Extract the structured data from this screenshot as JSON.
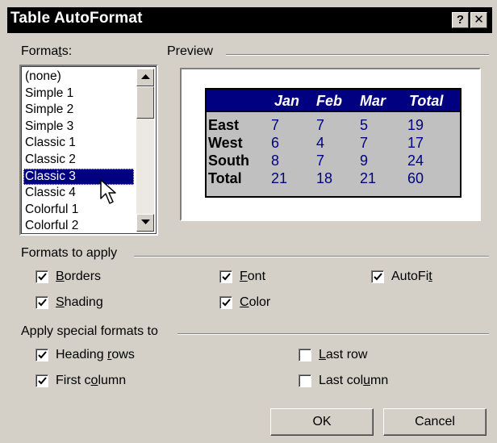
{
  "window": {
    "title": "Table AutoFormat",
    "help_btn": "?",
    "close_btn": "✕"
  },
  "formats": {
    "label_pre": "Forma",
    "label_key": "t",
    "label_post": "s:",
    "items": [
      "(none)",
      "Simple 1",
      "Simple 2",
      "Simple 3",
      "Classic 1",
      "Classic 2",
      "Classic 3",
      "Classic 4",
      "Colorful 1",
      "Colorful 2"
    ],
    "selected": "Classic 3"
  },
  "preview": {
    "label": "Preview",
    "header": [
      "",
      "Jan",
      "Feb",
      "Mar",
      "Total"
    ],
    "rows": [
      [
        "East",
        "7",
        "7",
        "5",
        "19"
      ],
      [
        "West",
        "6",
        "4",
        "7",
        "17"
      ],
      [
        "South",
        "8",
        "7",
        "9",
        "24"
      ],
      [
        "Total",
        "21",
        "18",
        "21",
        "60"
      ]
    ],
    "colors": {
      "header_bg": "#000080",
      "body_bg": "#c0c0c0",
      "value_text": "#000080"
    }
  },
  "formats_to_apply": {
    "label": "Formats to apply",
    "borders": {
      "key": "B",
      "rest": "orders",
      "checked": true
    },
    "font": {
      "key": "F",
      "rest": "ont",
      "checked": true
    },
    "autofit": {
      "pre": "AutoFi",
      "key": "t",
      "rest": "",
      "checked": true
    },
    "shading": {
      "key": "S",
      "rest": "hading",
      "checked": true
    },
    "color": {
      "key": "C",
      "rest": "olor",
      "checked": true
    }
  },
  "special_formats": {
    "label": "Apply special formats to",
    "heading_rows": {
      "pre": "Heading ",
      "key": "r",
      "rest": "ows",
      "checked": true
    },
    "last_row": {
      "key": "L",
      "rest": "ast row",
      "checked": false
    },
    "first_column": {
      "pre": "First c",
      "key": "o",
      "rest": "lumn",
      "checked": true
    },
    "last_column": {
      "pre": "Last col",
      "key": "u",
      "rest": "mn",
      "checked": false
    }
  },
  "buttons": {
    "ok": "OK",
    "cancel": "Cancel"
  }
}
